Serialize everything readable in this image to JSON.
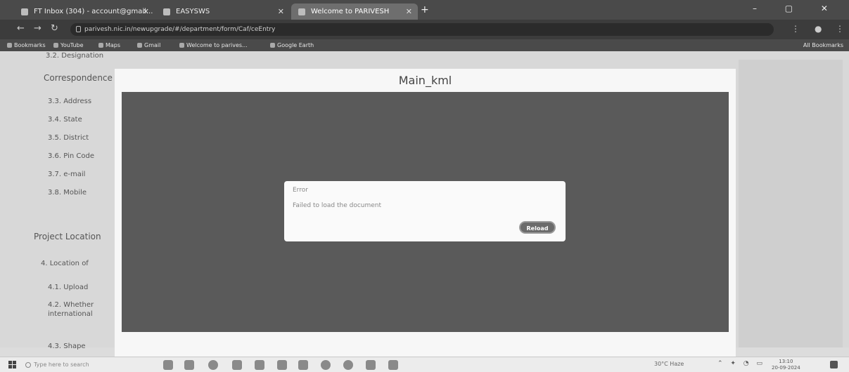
{
  "browser": {
    "tabs": [
      {
        "label": "FT Inbox (304) - account@gmail..."
      },
      {
        "label": "EASYSWS"
      },
      {
        "label": "Welcome to PARIVESH"
      }
    ],
    "new_tab_symbol": "+",
    "window_controls": "– ▢ ✕",
    "url": "parivesh.nic.in/newupgrade/#/department/form/Caf/ceEntry",
    "bookmarks": [
      {
        "label": "Bookmarks"
      },
      {
        "label": "YouTube"
      },
      {
        "label": "Maps"
      },
      {
        "label": "Gmail"
      },
      {
        "label": "Welcome to parives..."
      },
      {
        "label": "Google Earth"
      }
    ],
    "all_bookmarks": "All Bookmarks"
  },
  "page": {
    "top_cut": "3.2. Designation",
    "section_correspondence": "Correspondence",
    "items_left": [
      "3.3. Address",
      "3.4. State",
      "3.5. District",
      "3.6. Pin Code",
      "3.7. e-mail",
      "3.8. Mobile"
    ],
    "section_project": "Project Location",
    "items_location": [
      "4. Location of",
      "4.1. Upload",
      "4.2. Whether",
      "international"
    ],
    "bottom_cut": "4.3. Shape"
  },
  "modal": {
    "title": "Main_kml"
  },
  "dialog": {
    "title": "Error",
    "message": "Failed to load the document",
    "button": "Reload"
  },
  "taskbar": {
    "search_placeholder": "Type here to search",
    "weather": "30°C Haze",
    "tray_icons": "⌃ ✦ ◔ ▭",
    "time": "13:10",
    "date": "20-09-2024"
  }
}
